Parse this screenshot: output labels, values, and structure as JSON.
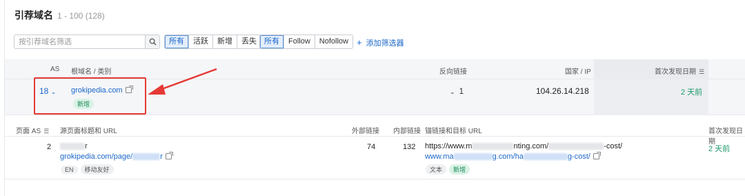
{
  "header": {
    "title": "引荐域名",
    "range": "1 - 100 (128)"
  },
  "filters": {
    "search_placeholder": "按引荐域名筛选",
    "status_options": [
      "所有",
      "活跃",
      "新增",
      "丢失"
    ],
    "status_selected": "所有",
    "follow_options": [
      "所有",
      "Follow",
      "Nofollow"
    ],
    "follow_selected": "所有",
    "add_filter": "添加筛选器"
  },
  "table": {
    "columns": {
      "as": "AS",
      "domain": "根域名 / 类别",
      "backlinks": "反向链接",
      "country_ip": "国家 / IP",
      "first_seen": "首次发现日期"
    },
    "row": {
      "as": "18",
      "domain": "grokipedia.com",
      "badge": "新增",
      "backlinks": "1",
      "ip": "104.26.14.218",
      "first_seen": "2 天前"
    }
  },
  "detail": {
    "columns": {
      "page_as": "页面 AS",
      "source": "源页面标题和 URL",
      "external": "外部链接",
      "internal": "内部链接",
      "anchor": "锚链接和目标 URL",
      "first_seen": "首次发现日期"
    },
    "row": {
      "page_as": "2",
      "title_suffix": "r",
      "url_prefix": "grokipedia.com/page/",
      "url_suffix": "r",
      "tags": [
        "EN",
        "移动友好"
      ],
      "external": "74",
      "internal": "132",
      "anchor_prefix": "https://www.m",
      "anchor_mid": "nting.com/",
      "anchor_suffix": "-cost/",
      "target_prefix": "www.ma",
      "target_mid": "g.com/ha",
      "target_suffix": "g-cost/",
      "anchor_tags": [
        "文本",
        "新增"
      ],
      "first_seen": "2 天前"
    }
  },
  "colors": {
    "accent": "#1a66c8",
    "new_green": "#1c9a6a",
    "callout_red": "#e53935"
  }
}
